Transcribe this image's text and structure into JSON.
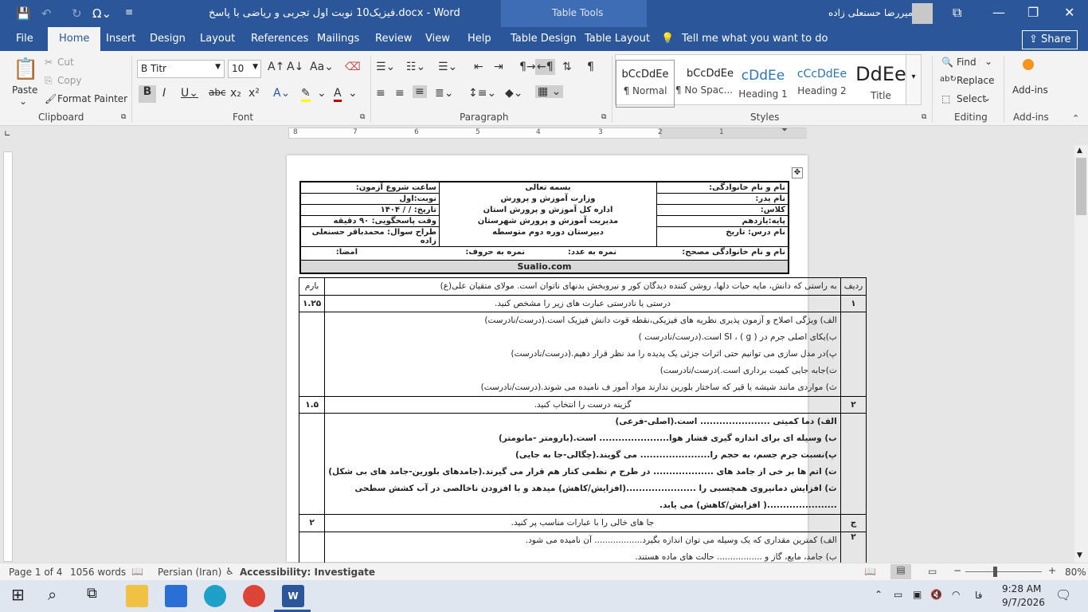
{
  "app": {
    "title": "فیزیک10 نوبت اول تجربی و ریاضی با پاسخ.docx  -  Word",
    "context": "Table Tools",
    "user": "امیررضا حسنعلی زاده"
  },
  "tabs": [
    "File",
    "Home",
    "Insert",
    "Design",
    "Layout",
    "References",
    "Mailings",
    "Review",
    "View",
    "Help",
    "Table Design",
    "Table Layout"
  ],
  "tell_me": "Tell me what you want to do",
  "share": "Share",
  "clipboard": {
    "paste": "Paste",
    "cut": "Cut",
    "copy": "Copy",
    "format_painter": "Format Painter",
    "label": "Clipboard"
  },
  "font": {
    "name": "B Titr",
    "size": "10",
    "label": "Font"
  },
  "paragraph": {
    "label": "Paragraph"
  },
  "styles": {
    "label": "Styles",
    "items": [
      {
        "preview": "bCcDdEe",
        "name": "¶ Normal"
      },
      {
        "preview": "bCcDdEe",
        "name": "¶ No Spac..."
      },
      {
        "preview": "cDdEe",
        "name": "Heading 1"
      },
      {
        "preview": "cCcDdEe",
        "name": "Heading 2"
      },
      {
        "preview": "DdEe",
        "name": "Title"
      }
    ]
  },
  "editing": {
    "find": "Find",
    "replace": "Replace",
    "select": "Select",
    "label": "Editing"
  },
  "addins": {
    "button": "Add-ins",
    "label": "Add-ins"
  },
  "ruler": {
    "numbers": [
      "8",
      "7",
      "6",
      "5",
      "4",
      "3",
      "2",
      "1"
    ]
  },
  "header": {
    "right": [
      "نام و نام خانوادگی:",
      "نام پدر:",
      "کلاس:",
      "پایه:یازدهم",
      "نام درس: تاریخ"
    ],
    "center": [
      "بسمه تعالی",
      "وزارت آموزش و پرورش",
      "اداره کل آموزش و پرورش استان",
      "مدیریت آموزش و پرورش شهرستان",
      "دبیرستان دوره دوم متوسطه"
    ],
    "left": [
      "ساعت شروع آزمون:",
      "نوبت:اول",
      "تاریخ:   /   /  ۱۴۰۴",
      "وقت پاسخگویی: ۹۰ دقیقه",
      "طراح سوال: محمدباقر حسنعلی زاده"
    ],
    "corrector": "نام و نام خانوادگی مصحح:",
    "score_digits": "نمره به عدد:",
    "score_letters": "نمره به حروف:",
    "signature": "امضا:",
    "site": "Sualio.com"
  },
  "questions": {
    "col_row": "ردیف",
    "col_score": "بارم",
    "intro": "به راستی که دانش، مایه حیات دلها، روشن کننده دیدگان کور و نیروبخش بدنهای ناتوان است. مولای متقیان علی(ع)",
    "q1": {
      "num": "۱",
      "title": "درستی یا نادرستی عبارت های زیر را مشخص کنید.",
      "score": "۱.۲۵",
      "lines": [
        "الف) ویژگی اصلاح و آزمون پذیری نظریه های فیزیکی،نقطه قوت دانش فیزیک است.(درست/نادرست)",
        "ب)یکای اصلی جرم در SI ، ( g ) است.(درست/نادرست )",
        "پ)در مدل سازی می توانیم حتی اثرات جزئی یک پدیده را مد نظر قرار دهیم.(درست/نادرست)",
        "ت)جابه جایی کمیت برداری است.)درست/نادرست)",
        "ث) مواردی مانند شیشه یا قیر که ساختار بلورین ندارند مواد آمور ف نامیده می شوند.(درست/نادرست)"
      ]
    },
    "q2": {
      "num": "۲",
      "title": "گزینه درست را انتخاب کنید.",
      "score": "۱.۵",
      "lines": [
        "الف) دما کمیتی ...................... است.(اصلی-فرعی)",
        "ب) وسیله ای برای اندازه گیری فشار هوا...................... است.(بارومتر -مانومتر)",
        "پ)نسبت جرم جسم، به حجم را...................... می گویند.(چگالی-جا به جایی)",
        "ت) اتم ها بر خی از جامد های ................... در طرح م نظمی کنار هم قرار می گیرند.(جامدهای بلورین-جامد های بی شکل)",
        "ث) افزایش دمانیروی همچسبی را ......................(افزایش/کاهش) میدهد و با افزودن ناخالصی در آب کشش سطحی",
        "......................( افزایش/کاهش) می یابد."
      ]
    },
    "q3": {
      "num": "ج",
      "title": "جا های خالی را با عبارات مناسب پر کنید.",
      "score": "۲"
    },
    "q4": {
      "num": "۲",
      "lines": [
        "الف) کمترین مقداری که یک وسیله می توان اندازه بگیرد.................. آن نامیده می شود.",
        "ب) جامد، مایع، گاز و ................. حالت های ماده هستند."
      ]
    }
  },
  "status": {
    "page": "Page 1 of 4",
    "words": "1056 words",
    "language": "Persian (Iran)",
    "accessibility": "Accessibility: Investigate",
    "zoom": "80%"
  },
  "taskbar": {
    "time": "9:28 AM",
    "date": "9/7/2026",
    "lang": "فا"
  }
}
